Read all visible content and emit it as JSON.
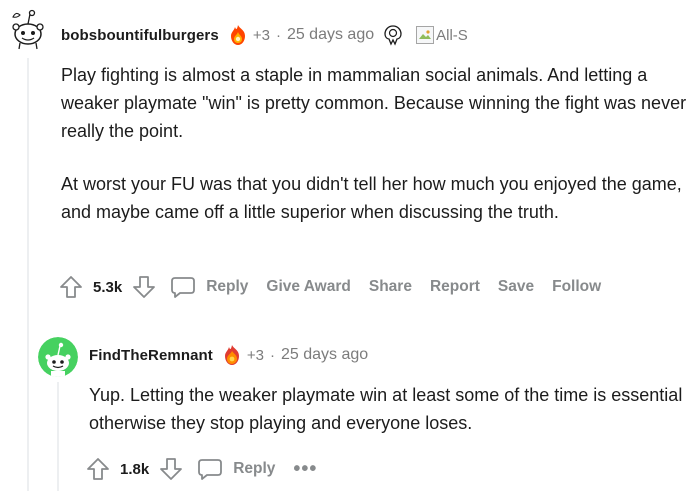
{
  "comment": {
    "username": "bobsbountifulburgers",
    "flair_count": "+3",
    "separator": "·",
    "timestamp": "25 days ago",
    "broken_image_alt": "All-S",
    "paragraphs": [
      "Play fighting is almost a staple in mammalian social animals. And letting a weaker playmate \"win\" is pretty common. Because winning the fight was never really the point.",
      "At worst your FU was that you didn't tell her how much you enjoyed the game, and maybe came off a little superior when discussing the truth."
    ],
    "votes": "5.3k",
    "actions": {
      "reply": "Reply",
      "give_award": "Give Award",
      "share": "Share",
      "report": "Report",
      "save": "Save",
      "follow": "Follow"
    }
  },
  "reply": {
    "username": "FindTheRemnant",
    "flair_count": "+3",
    "separator": "·",
    "timestamp": "25 days ago",
    "text": "Yup. Letting the weaker playmate win at least some of the time is essential otherwise they stop playing and everyone loses.",
    "votes": "1.8k",
    "actions": {
      "reply": "Reply",
      "more": "•••"
    }
  },
  "icons": {
    "avatar_1": "snoo-avatar-icon",
    "avatar_2": "snoo-green-avatar-icon",
    "flair": "burning-award-icon",
    "award": "wholesome-seal-icon",
    "upvote": "arrow-up-icon",
    "downvote": "arrow-down-icon",
    "reply": "speech-bubble-icon"
  },
  "colors": {
    "text": "#1c1c1c",
    "muted": "#7c7c7c",
    "action": "#878a8c",
    "thread": "#edeff1",
    "avatar_2_bg": "#46d160"
  }
}
